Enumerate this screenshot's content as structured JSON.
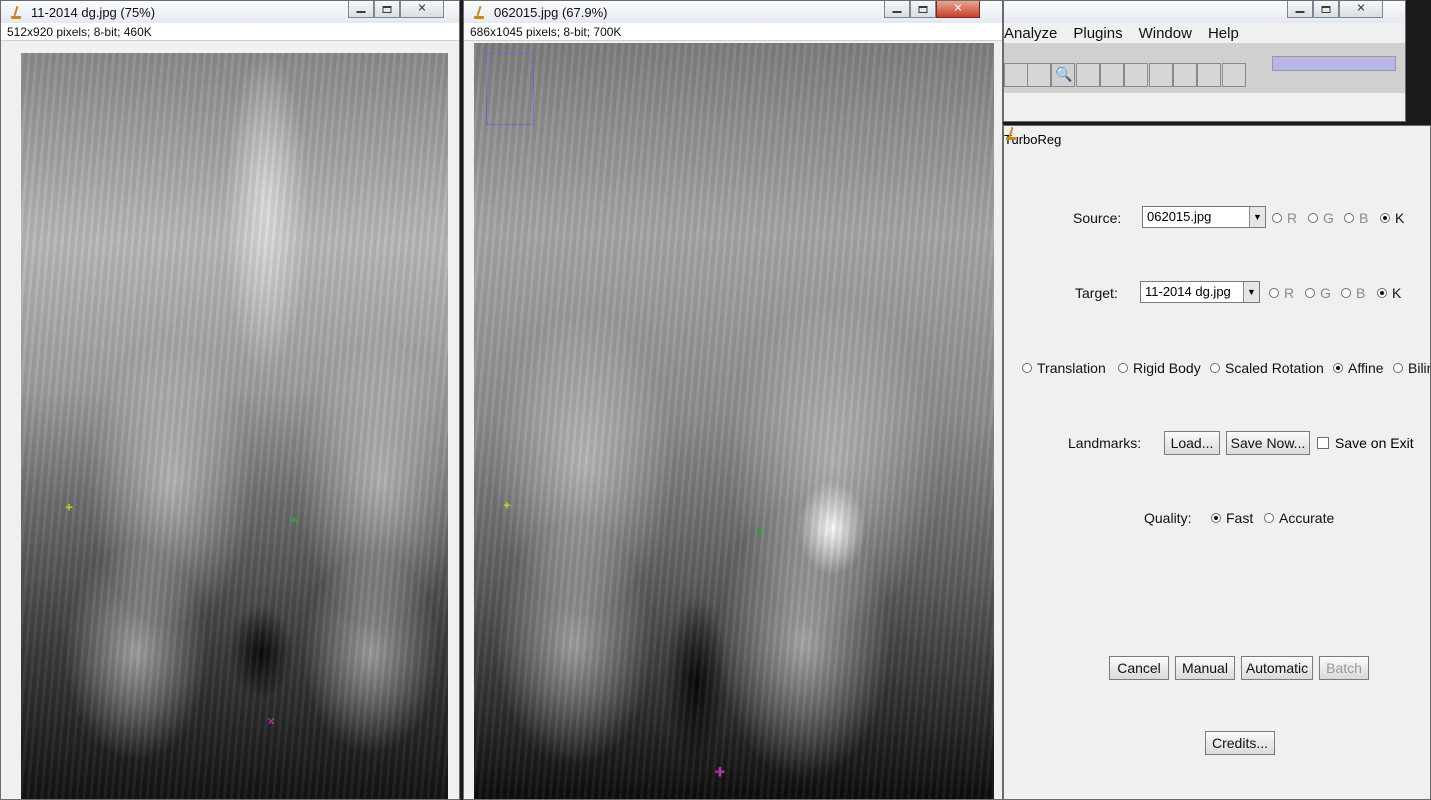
{
  "windows": {
    "image1": {
      "title": "11-2014 dg.jpg (75%)",
      "info": "512x920 pixels; 8-bit; 460K"
    },
    "image2": {
      "title": "062015.jpg (67.9%)",
      "info": "686x1045 pixels; 8-bit; 700K"
    },
    "imagej": {
      "menus": [
        "Analyze",
        "Plugins",
        "Window",
        "Help"
      ]
    },
    "turboreg": {
      "title": "TurboReg",
      "source_label": "Source:",
      "source_value": "062015.jpg",
      "target_label": "Target:",
      "target_value": "11-2014 dg.jpg",
      "channels": [
        "R",
        "G",
        "B",
        "K"
      ],
      "channel_selected": "K",
      "transformations": [
        "Translation",
        "Rigid Body",
        "Scaled Rotation",
        "Affine",
        "Bilin"
      ],
      "transformation_selected": "Affine",
      "landmarks_label": "Landmarks:",
      "load_label": "Load...",
      "save_now_label": "Save Now...",
      "save_on_exit_label": "Save on Exit",
      "quality_label": "Quality:",
      "quality_options": [
        "Fast",
        "Accurate"
      ],
      "quality_selected": "Fast",
      "cancel_label": "Cancel",
      "manual_label": "Manual",
      "automatic_label": "Automatic",
      "batch_label": "Batch",
      "credits_label": "Credits..."
    }
  },
  "glyphs": {
    "close": "✕",
    "dropdown": "▼",
    "plus": "+",
    "cross": "×",
    "bold_plus": "✚",
    "magnifier": "🔍"
  },
  "colors": {
    "landmark_yellow": "#d7d21f",
    "landmark_green": "#28b43a",
    "landmark_magenta": "#b02ca8",
    "close_button_red": "#c6412a",
    "progress_lavender": "#b8b6e6"
  }
}
